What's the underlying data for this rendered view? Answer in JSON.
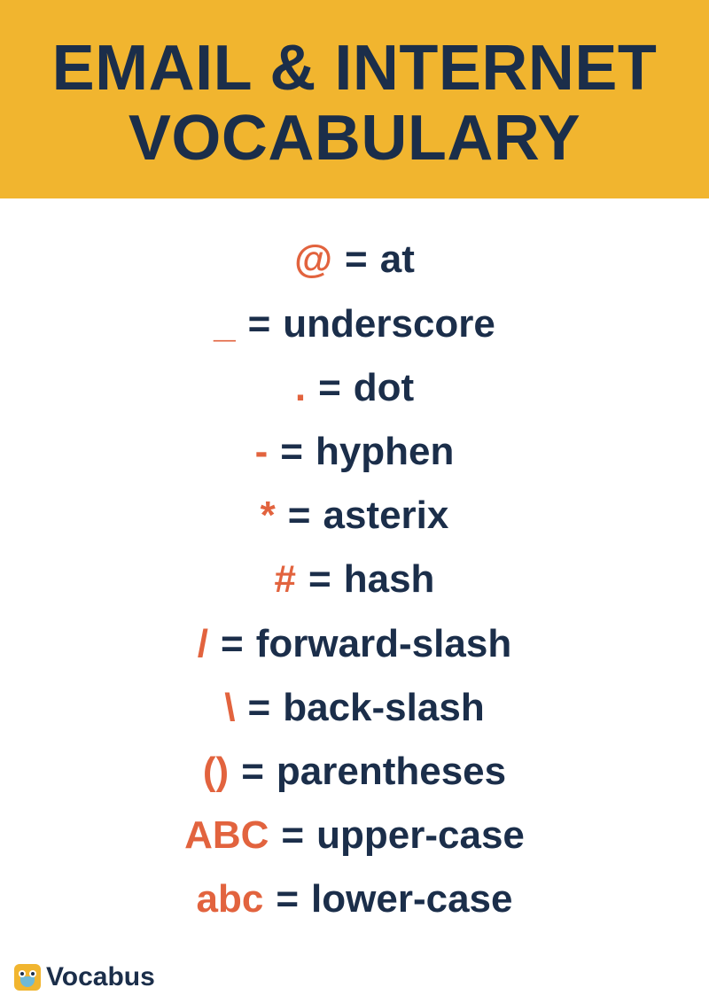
{
  "header": {
    "title_line1": "EMAIL & INTERNET",
    "title_line2": "VOCABULARY"
  },
  "rows": [
    {
      "symbol": "@",
      "eq": "=",
      "word": "at"
    },
    {
      "symbol": "_",
      "eq": "=",
      "word": "underscore"
    },
    {
      "symbol": ".",
      "eq": "=",
      "word": "dot"
    },
    {
      "symbol": "-",
      "eq": "=",
      "word": "hyphen"
    },
    {
      "symbol": "*",
      "eq": "=",
      "word": "asterix"
    },
    {
      "symbol": "#",
      "eq": "=",
      "word": "hash"
    },
    {
      "symbol": "/",
      "eq": "=",
      "word": "forward-slash"
    },
    {
      "symbol": "\\",
      "eq": "=",
      "word": "back-slash"
    },
    {
      "symbol": "()",
      "eq": "=",
      "word": "parentheses"
    },
    {
      "symbol": "ABC",
      "eq": "=",
      "word": "upper-case"
    },
    {
      "symbol": "abc",
      "eq": "=",
      "word": "lower-case"
    }
  ],
  "footer": {
    "brand": "Vocabus"
  }
}
